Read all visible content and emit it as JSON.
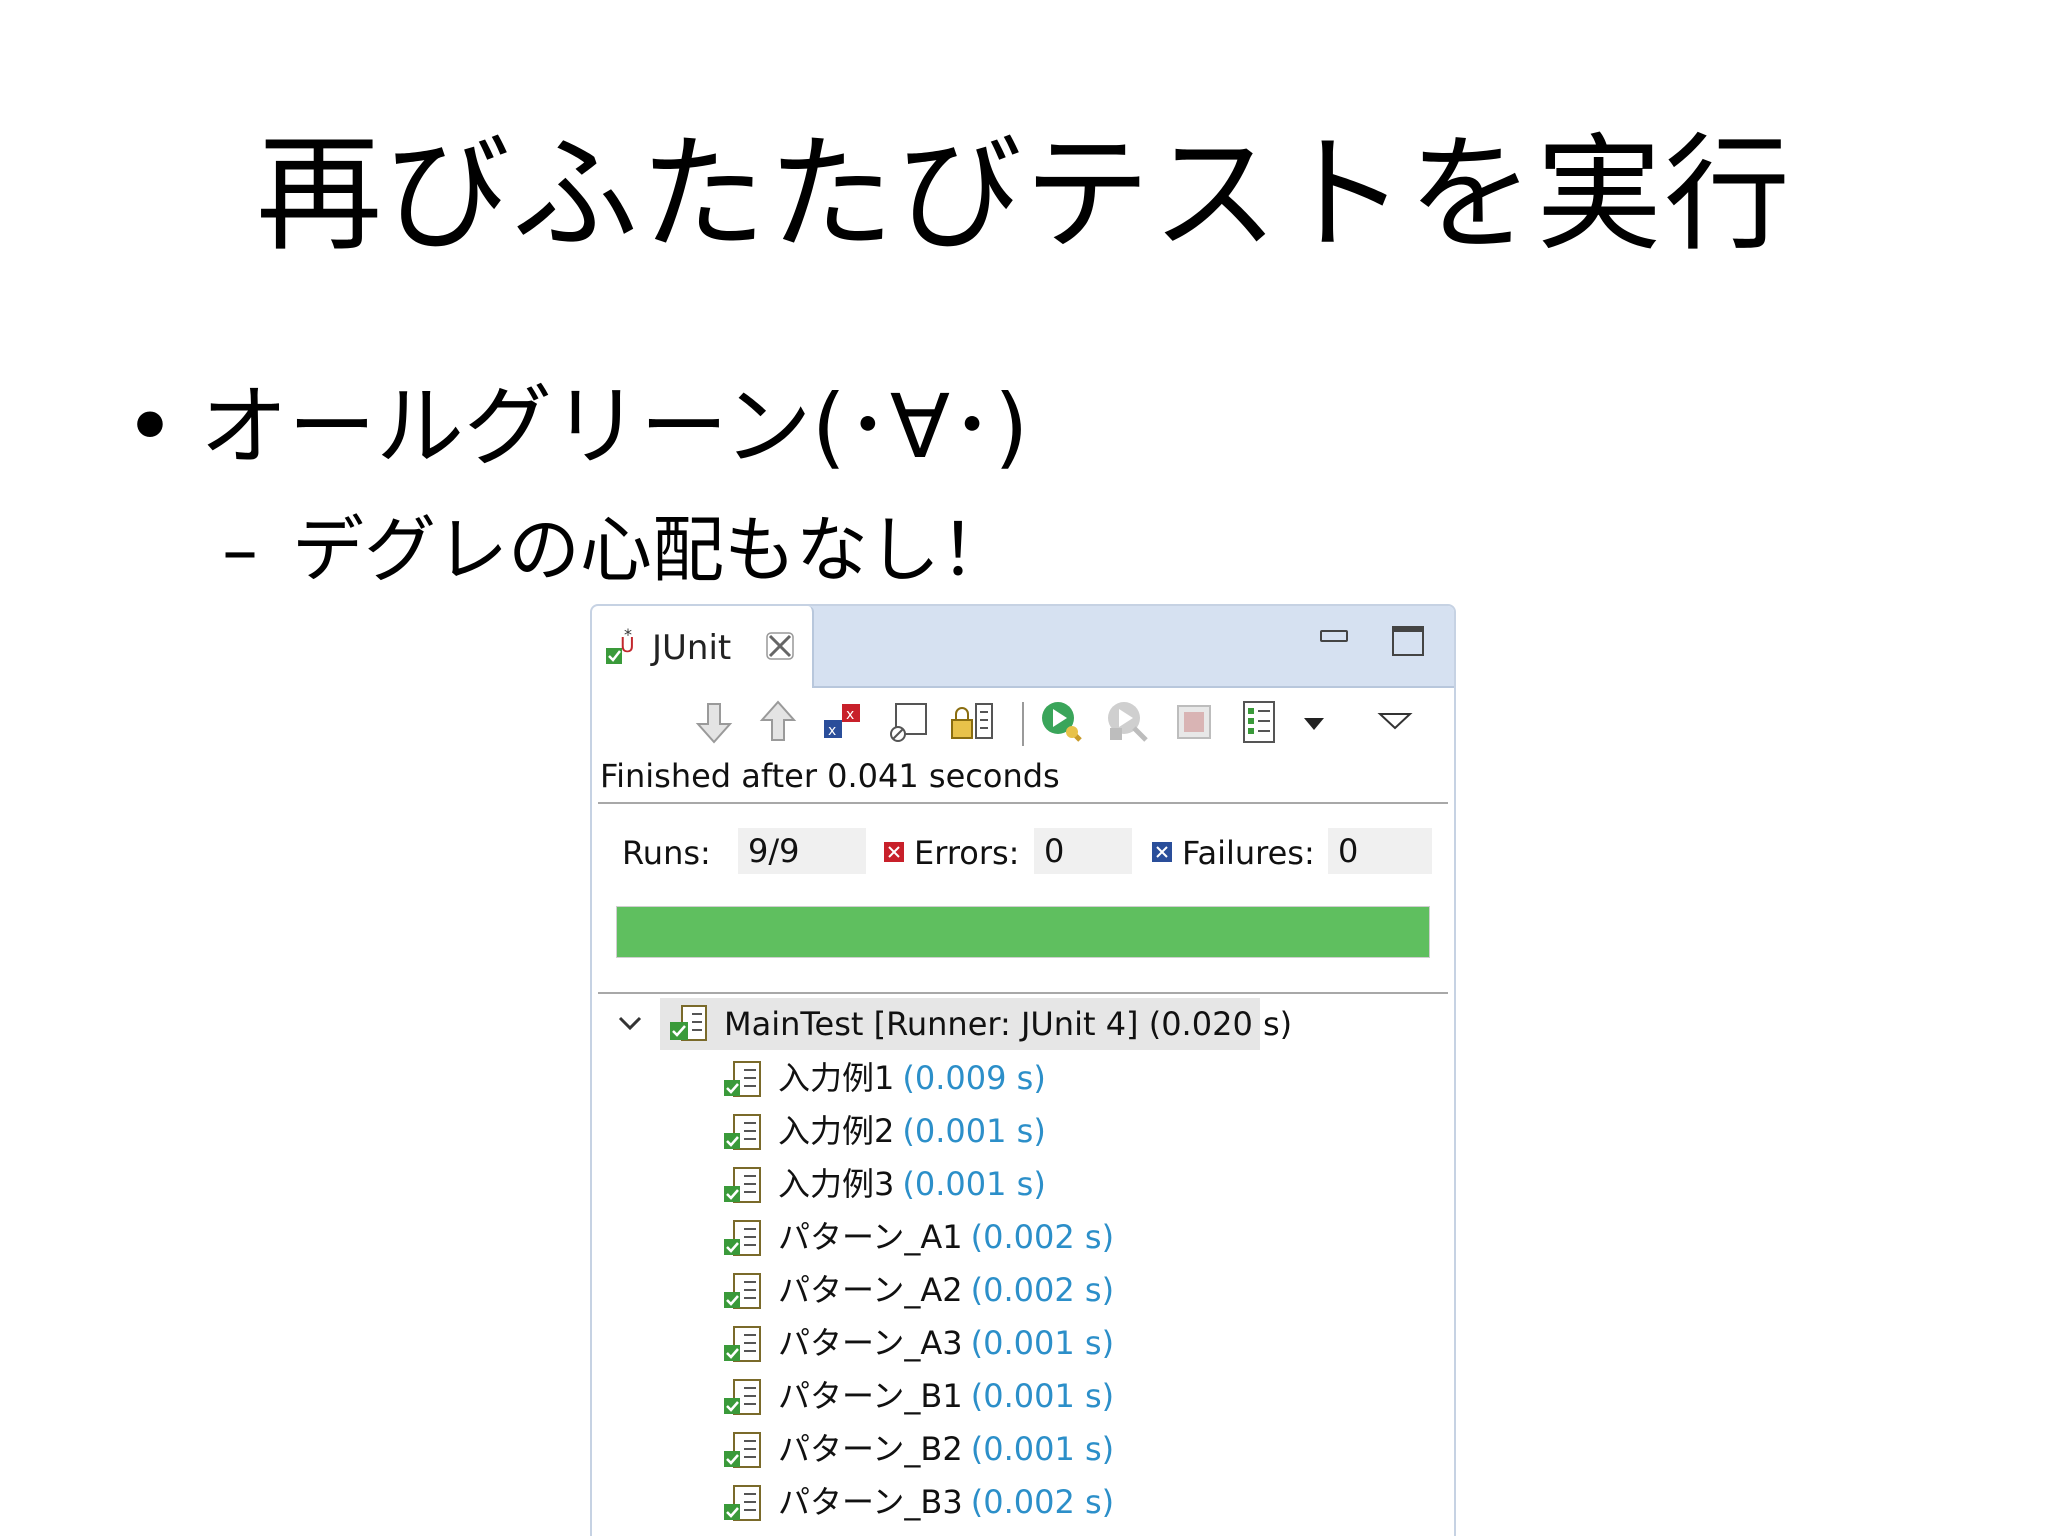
{
  "slide": {
    "title": "再びふたたびテストを実行",
    "bullet1": "オールグリーン(･∀･)",
    "bullet1_marker": "•",
    "bullet2": "デグレの心配もなし！",
    "bullet2_marker": "–"
  },
  "junit": {
    "tab_label": "JUnit",
    "status": "Finished after 0.041 seconds",
    "runs_label": "Runs:",
    "runs_value": "9/9",
    "errors_label": "Errors:",
    "errors_value": "0",
    "failures_label": "Failures:",
    "failures_value": "0",
    "progress_fraction": 1.0,
    "progress_color": "#5fbf5f",
    "toolbar_icons": [
      "next-failure-icon",
      "previous-failure-icon",
      "show-failures-only-icon",
      "scroll-lock-icon",
      "show-skipped-icon",
      "rerun-test-icon",
      "rerun-failed-first-icon",
      "stop-icon",
      "test-run-history-icon",
      "history-dropdown-icon",
      "view-menu-icon"
    ],
    "root": {
      "label": "MainTest [Runner: JUnit 4] (0.020 s)"
    },
    "tests": [
      {
        "name": "入力例1",
        "time": "(0.009 s)"
      },
      {
        "name": "入力例2",
        "time": "(0.001 s)"
      },
      {
        "name": "入力例3",
        "time": "(0.001 s)"
      },
      {
        "name": "パターン_A1",
        "time": "(0.002 s)"
      },
      {
        "name": "パターン_A2",
        "time": "(0.002 s)"
      },
      {
        "name": "パターン_A3",
        "time": "(0.001 s)"
      },
      {
        "name": "パターン_B1",
        "time": "(0.001 s)"
      },
      {
        "name": "パターン_B2",
        "time": "(0.001 s)"
      },
      {
        "name": "パターン_B3",
        "time": "(0.002 s)"
      }
    ],
    "time_color": "#2c8fc9"
  }
}
